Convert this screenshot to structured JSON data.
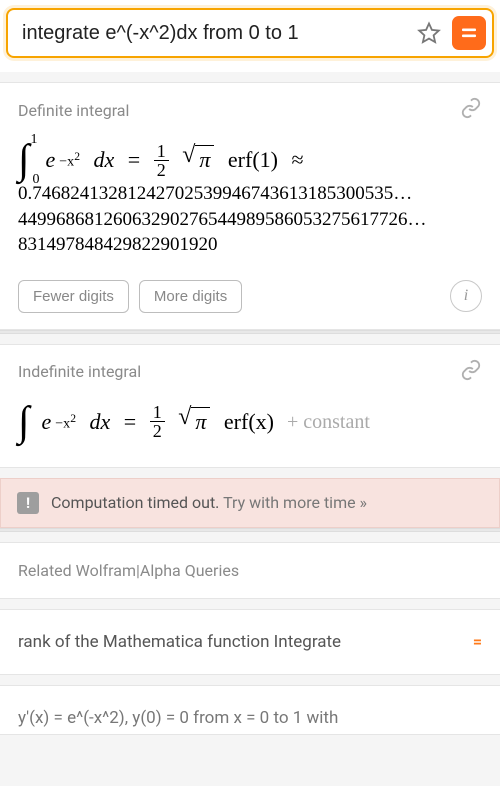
{
  "search": {
    "query": "integrate e^(-x^2)dx from 0 to 1"
  },
  "sections": {
    "definite": {
      "title": "Definite integral",
      "lower_limit": "0",
      "upper_limit": "1",
      "integrand_base": "e",
      "integrand_exp": "−x",
      "integrand_exp_pow": "2",
      "dx": "dx",
      "equals": "=",
      "coeff_num": "1",
      "coeff_den": "2",
      "pi": "π",
      "erf_label": "erf(1)",
      "approx": "≈",
      "value_lines": [
        "0.74682413281242702539946743613185300535…",
        "44996868126063290276544989586053275617726…",
        "831497848429822901920"
      ],
      "fewer_btn": "Fewer digits",
      "more_btn": "More digits"
    },
    "indefinite": {
      "title": "Indefinite integral",
      "integrand_base": "e",
      "integrand_exp": "−x",
      "integrand_exp_pow": "2",
      "dx": "dx",
      "equals": "=",
      "coeff_num": "1",
      "coeff_den": "2",
      "pi": "π",
      "erf_label": "erf(x)",
      "constant": "+ constant"
    }
  },
  "timeout": {
    "message": "Computation timed out.",
    "link": "Try with more time »"
  },
  "related": {
    "title": "Related Wolfram|Alpha Queries",
    "items": [
      {
        "label": "rank of the Mathematica function Integrate",
        "symbol": "="
      },
      {
        "label": "y'(x) = e^(-x^2), y(0) = 0 from x = 0 to 1 with",
        "symbol": ""
      }
    ]
  },
  "icons": {
    "star": "star-outline",
    "compute": "equals",
    "link": "chain-link",
    "info": "i"
  },
  "colors": {
    "accent": "#ff6b1a",
    "border_focus": "#f7a400"
  }
}
